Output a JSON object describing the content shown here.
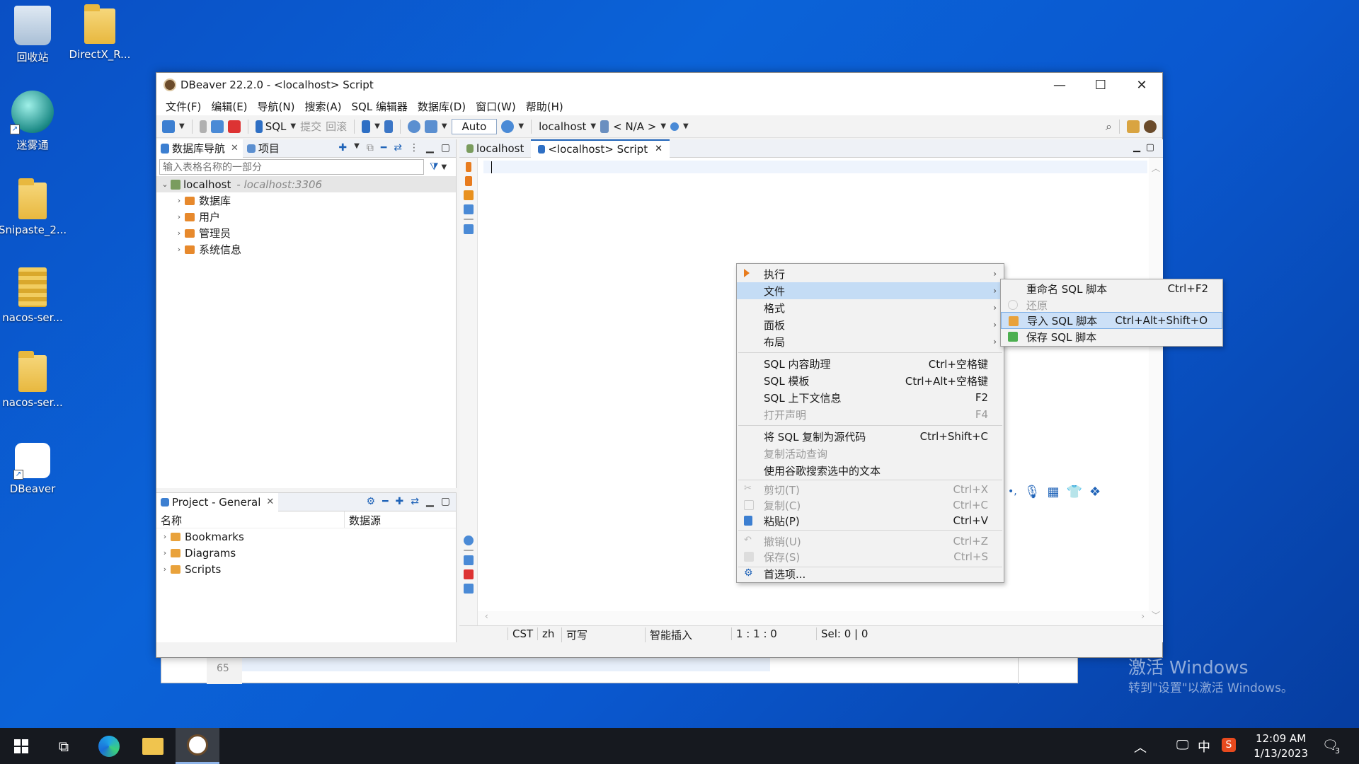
{
  "desktop": {
    "icons": [
      {
        "label": "回收站"
      },
      {
        "label": "DirectX_R..."
      },
      {
        "label": "迷雾通"
      },
      {
        "label": "Snipaste_2..."
      },
      {
        "label": "nacos-ser..."
      },
      {
        "label": "nacos-ser..."
      },
      {
        "label": "DBeaver"
      }
    ]
  },
  "window": {
    "title": "DBeaver 22.2.0 - <localhost> Script",
    "menu": [
      "文件(F)",
      "编辑(E)",
      "导航(N)",
      "搜索(A)",
      "SQL 编辑器",
      "数据库(D)",
      "窗口(W)",
      "帮助(H)"
    ],
    "toolbar": {
      "sql_label": "SQL",
      "commit_label": "提交",
      "rollback_label": "回滚",
      "auto_label": "Auto",
      "connection_label": "localhost",
      "schema_label": "< N/A >"
    }
  },
  "navigator": {
    "tabs": [
      "数据库导航",
      "项目"
    ],
    "filter_placeholder": "输入表格名称的一部分",
    "root": {
      "label": "localhost",
      "detail": "- localhost:3306"
    },
    "children": [
      "数据库",
      "用户",
      "管理员",
      "系统信息"
    ]
  },
  "project": {
    "tab": "Project - General",
    "columns": [
      "名称",
      "数据源"
    ],
    "items": [
      "Bookmarks",
      "Diagrams",
      "Scripts"
    ]
  },
  "editor": {
    "tabs": [
      "localhost",
      "<localhost> Script"
    ]
  },
  "status": {
    "tz": "CST",
    "lang": "zh",
    "mode": "可写",
    "insert": "智能插入",
    "pos": "1 : 1 : 0",
    "sel": "Sel: 0 | 0"
  },
  "context_menu": {
    "items": [
      {
        "label": "执行",
        "submenu": true
      },
      {
        "label": "文件",
        "submenu": true
      },
      {
        "label": "格式",
        "submenu": true
      },
      {
        "label": "面板",
        "submenu": true
      },
      {
        "label": "布局",
        "submenu": true
      },
      {
        "label": "SQL 内容助理",
        "shortcut": "Ctrl+空格键"
      },
      {
        "label": "SQL 模板",
        "shortcut": "Ctrl+Alt+空格键"
      },
      {
        "label": "SQL 上下文信息",
        "shortcut": "F2"
      },
      {
        "label": "打开声明",
        "shortcut": "F4"
      },
      {
        "label": "将 SQL 复制为源代码",
        "shortcut": "Ctrl+Shift+C"
      },
      {
        "label": "复制活动查询"
      },
      {
        "label": "使用谷歌搜索选中的文本"
      },
      {
        "label": "剪切(T)",
        "shortcut": "Ctrl+X"
      },
      {
        "label": "复制(C)",
        "shortcut": "Ctrl+C"
      },
      {
        "label": "粘贴(P)",
        "shortcut": "Ctrl+V"
      },
      {
        "label": "撤销(U)",
        "shortcut": "Ctrl+Z"
      },
      {
        "label": "保存(S)",
        "shortcut": "Ctrl+S"
      },
      {
        "label": "首选项..."
      }
    ]
  },
  "submenu": {
    "items": [
      {
        "label": "重命名 SQL 脚本",
        "shortcut": "Ctrl+F2"
      },
      {
        "label": "还原"
      },
      {
        "label": "导入 SQL 脚本",
        "shortcut": "Ctrl+Alt+Shift+O"
      },
      {
        "label": "保存 SQL 脚本"
      }
    ]
  },
  "background_window": {
    "line_number": "65"
  },
  "watermark": {
    "line1": "激活 Windows",
    "line2": "转到\"设置\"以激活 Windows。"
  },
  "taskbar": {
    "time": "12:09 AM",
    "date": "1/13/2023",
    "ime": "中",
    "notifications": "3"
  },
  "colors": {
    "accent": "#1f63b8",
    "menu_highlight": "#c4dcf5",
    "folder": "#e7892c"
  }
}
